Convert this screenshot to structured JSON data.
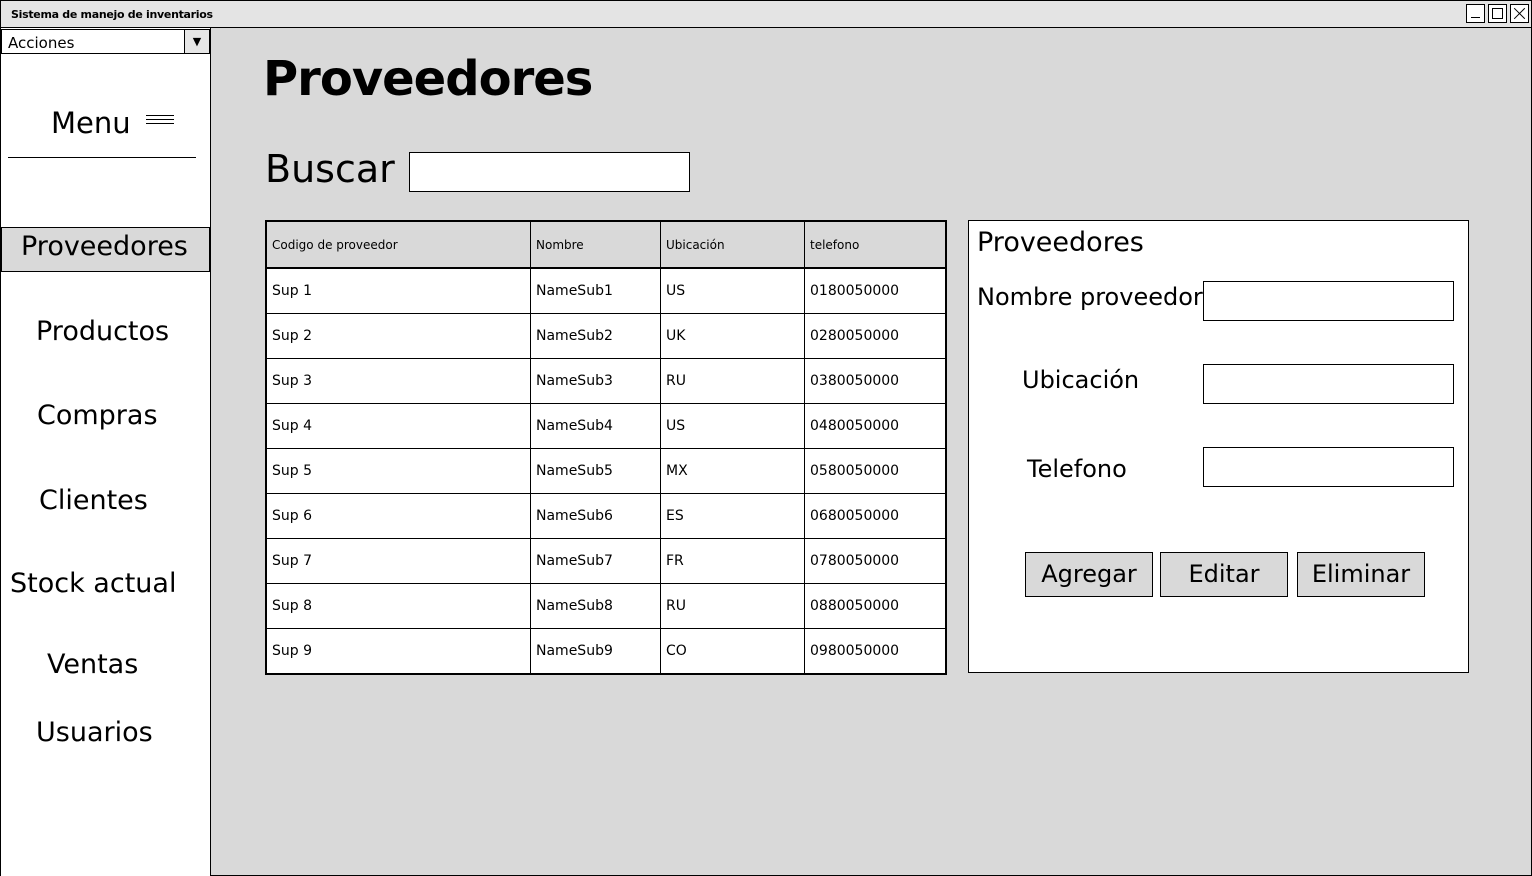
{
  "window": {
    "title": "Sistema de manejo de inventarios"
  },
  "actions_combo": {
    "value": "Acciones"
  },
  "sidebar": {
    "menu_label": "Menu",
    "items": [
      {
        "label": "Proveedores",
        "active": true
      },
      {
        "label": "Productos"
      },
      {
        "label": "Compras"
      },
      {
        "label": "Clientes"
      },
      {
        "label": "Stock actual"
      },
      {
        "label": "Ventas"
      },
      {
        "label": "Usuarios"
      }
    ]
  },
  "main": {
    "title": "Proveedores",
    "search": {
      "label": "Buscar",
      "value": ""
    },
    "table": {
      "columns": [
        "Codigo de proveedor",
        "Nombre",
        "Ubicación",
        "telefono"
      ],
      "rows": [
        [
          "Sup 1",
          "NameSub1",
          "US",
          "0180050000"
        ],
        [
          "Sup 2",
          "NameSub2",
          "UK",
          "0280050000"
        ],
        [
          "Sup 3",
          "NameSub3",
          "RU",
          "0380050000"
        ],
        [
          "Sup 4",
          "NameSub4",
          "US",
          "0480050000"
        ],
        [
          "Sup 5",
          "NameSub5",
          "MX",
          "0580050000"
        ],
        [
          "Sup 6",
          "NameSub6",
          "ES",
          "0680050000"
        ],
        [
          "Sup 7",
          "NameSub7",
          "FR",
          "0780050000"
        ],
        [
          "Sup 8",
          "NameSub8",
          "RU",
          "0880050000"
        ],
        [
          "Sup 9",
          "NameSub9",
          "CO",
          "0980050000"
        ]
      ]
    }
  },
  "form": {
    "title": "Proveedores",
    "fields": {
      "nombre_label": "Nombre proveedor",
      "ubicacion_label": "Ubicación",
      "telefono_label": "Telefono"
    },
    "buttons": {
      "add": "Agregar",
      "edit": "Editar",
      "delete": "Eliminar"
    }
  }
}
